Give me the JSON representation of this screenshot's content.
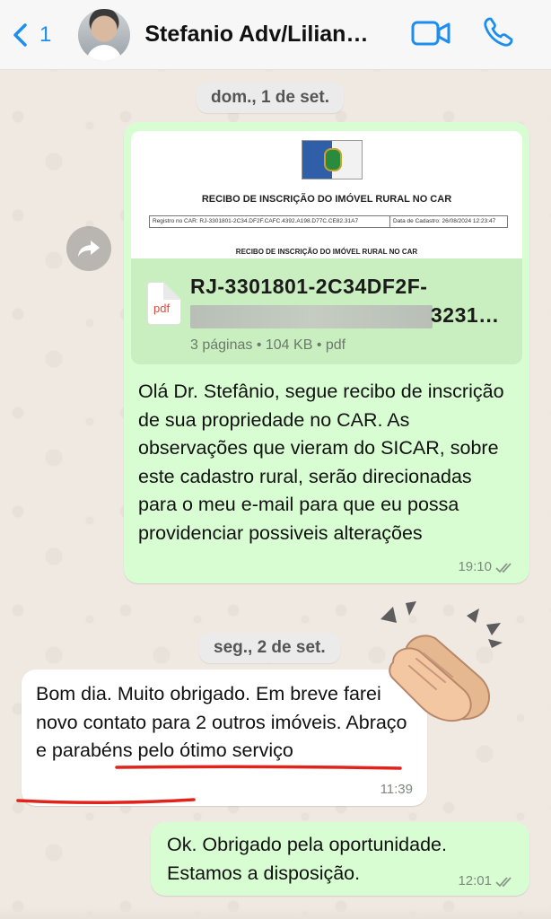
{
  "header": {
    "back_count": "1",
    "contact_name": "Stefanio Adv/Lilian…"
  },
  "dates": {
    "first": "dom., 1 de set.",
    "second": "seg., 2 de set."
  },
  "document": {
    "preview_title": "RECIBO DE INSCRIÇÃO DO IMÓVEL RURAL NO CAR",
    "preview_registry": "Registro no CAR: RJ-3301801-2C34.DF2F.CAFC.4392.A198.D77C.CE82.31A7",
    "preview_date": "Data de Cadastro: 26/08/2024 12:23:47",
    "preview_subtitle": "RECIBO DE INSCRIÇÃO DO IMÓVEL RURAL NO CAR",
    "file_type": "pdf",
    "file_name_line1": "RJ-3301801-2C34DF2F-",
    "file_name_line2": "3231…",
    "file_meta": "3 páginas • 104 KB • pdf"
  },
  "messages": [
    {
      "direction": "outgoing",
      "text": "Olá Dr. Stefânio, segue recibo de inscrição de sua propriedade no CAR. As observações que vieram do SICAR, sobre este cadastro rural, serão direcionadas para o meu e-mail para que eu possa providenciar possiveis alterações",
      "time": "19:10",
      "status": "read"
    },
    {
      "direction": "incoming",
      "text": "Bom dia. Muito obrigado. Em breve farei novo contato para 2 outros imóveis. Abraço e parabéns pelo ótimo serviço",
      "time": "11:39"
    },
    {
      "direction": "outgoing",
      "text": "Ok. Obrigado pela oportunidade. Estamos a disposição.",
      "time": "12:01",
      "status": "read"
    }
  ],
  "colors": {
    "outgoing_bubble": "#d9fdd3",
    "incoming_bubble": "#ffffff",
    "accent_blue": "#1c8ef0",
    "underline_red": "#e0231b"
  },
  "icons": [
    "back-chevron-icon",
    "video-call-icon",
    "phone-icon",
    "forward-icon",
    "pdf-icon",
    "double-check-icon",
    "clapping-hands-emoji"
  ]
}
